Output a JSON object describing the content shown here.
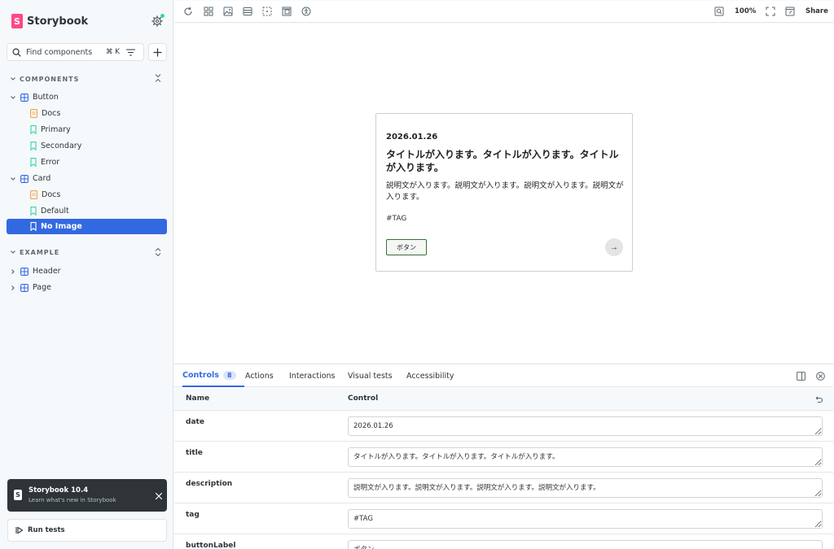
{
  "app": {
    "name": "Storybook"
  },
  "sidebar": {
    "search_placeholder": "Find components",
    "search_shortcut": "⌘ K",
    "sections": [
      {
        "title": "COMPONENTS"
      },
      {
        "title": "EXAMPLE"
      }
    ],
    "tree": [
      {
        "label": "Button",
        "kind": "component"
      },
      {
        "label": "Docs",
        "kind": "docs"
      },
      {
        "label": "Primary",
        "kind": "story"
      },
      {
        "label": "Secondary",
        "kind": "story"
      },
      {
        "label": "Error",
        "kind": "story"
      },
      {
        "label": "Card",
        "kind": "component"
      },
      {
        "label": "Docs",
        "kind": "docs"
      },
      {
        "label": "Default",
        "kind": "story"
      },
      {
        "label": "No Image",
        "kind": "story",
        "selected": true
      },
      {
        "label": "Header",
        "kind": "component"
      },
      {
        "label": "Page",
        "kind": "component"
      }
    ],
    "notice": {
      "title": "Storybook 10.4",
      "subtitle": "Learn what's new in Storybook"
    },
    "run_tests": "Run tests"
  },
  "toolbar": {
    "zoom": "100%",
    "share": "Share"
  },
  "preview": {
    "card": {
      "date": "2026.01.26",
      "title": "タイトルが入ります。タイトルが入ります。タイトルが入ります。",
      "description": "説明文が入ります。説明文が入ります。説明文が入ります。説明文が入ります。",
      "tag": "#TAG",
      "button_label": "ボタン",
      "arrow": "→"
    }
  },
  "panel": {
    "tabs": [
      {
        "label": "Controls",
        "badge": "8",
        "active": true
      },
      {
        "label": "Actions"
      },
      {
        "label": "Interactions"
      },
      {
        "label": "Visual tests"
      },
      {
        "label": "Accessibility"
      }
    ],
    "headers": {
      "name": "Name",
      "control": "Control"
    },
    "controls": [
      {
        "name": "date",
        "value": "2026.01.26"
      },
      {
        "name": "title",
        "value": "タイトルが入ります。タイトルが入ります。タイトルが入ります。"
      },
      {
        "name": "description",
        "value": "説明文が入ります。説明文が入ります。説明文が入ります。説明文が入ります。"
      },
      {
        "name": "tag",
        "value": "#TAG"
      },
      {
        "name": "buttonLabel",
        "value": "ボタン"
      }
    ]
  },
  "colors": {
    "accent": "#3369e0",
    "brand": "#ff4785",
    "status_dot": "#37d5a3"
  }
}
